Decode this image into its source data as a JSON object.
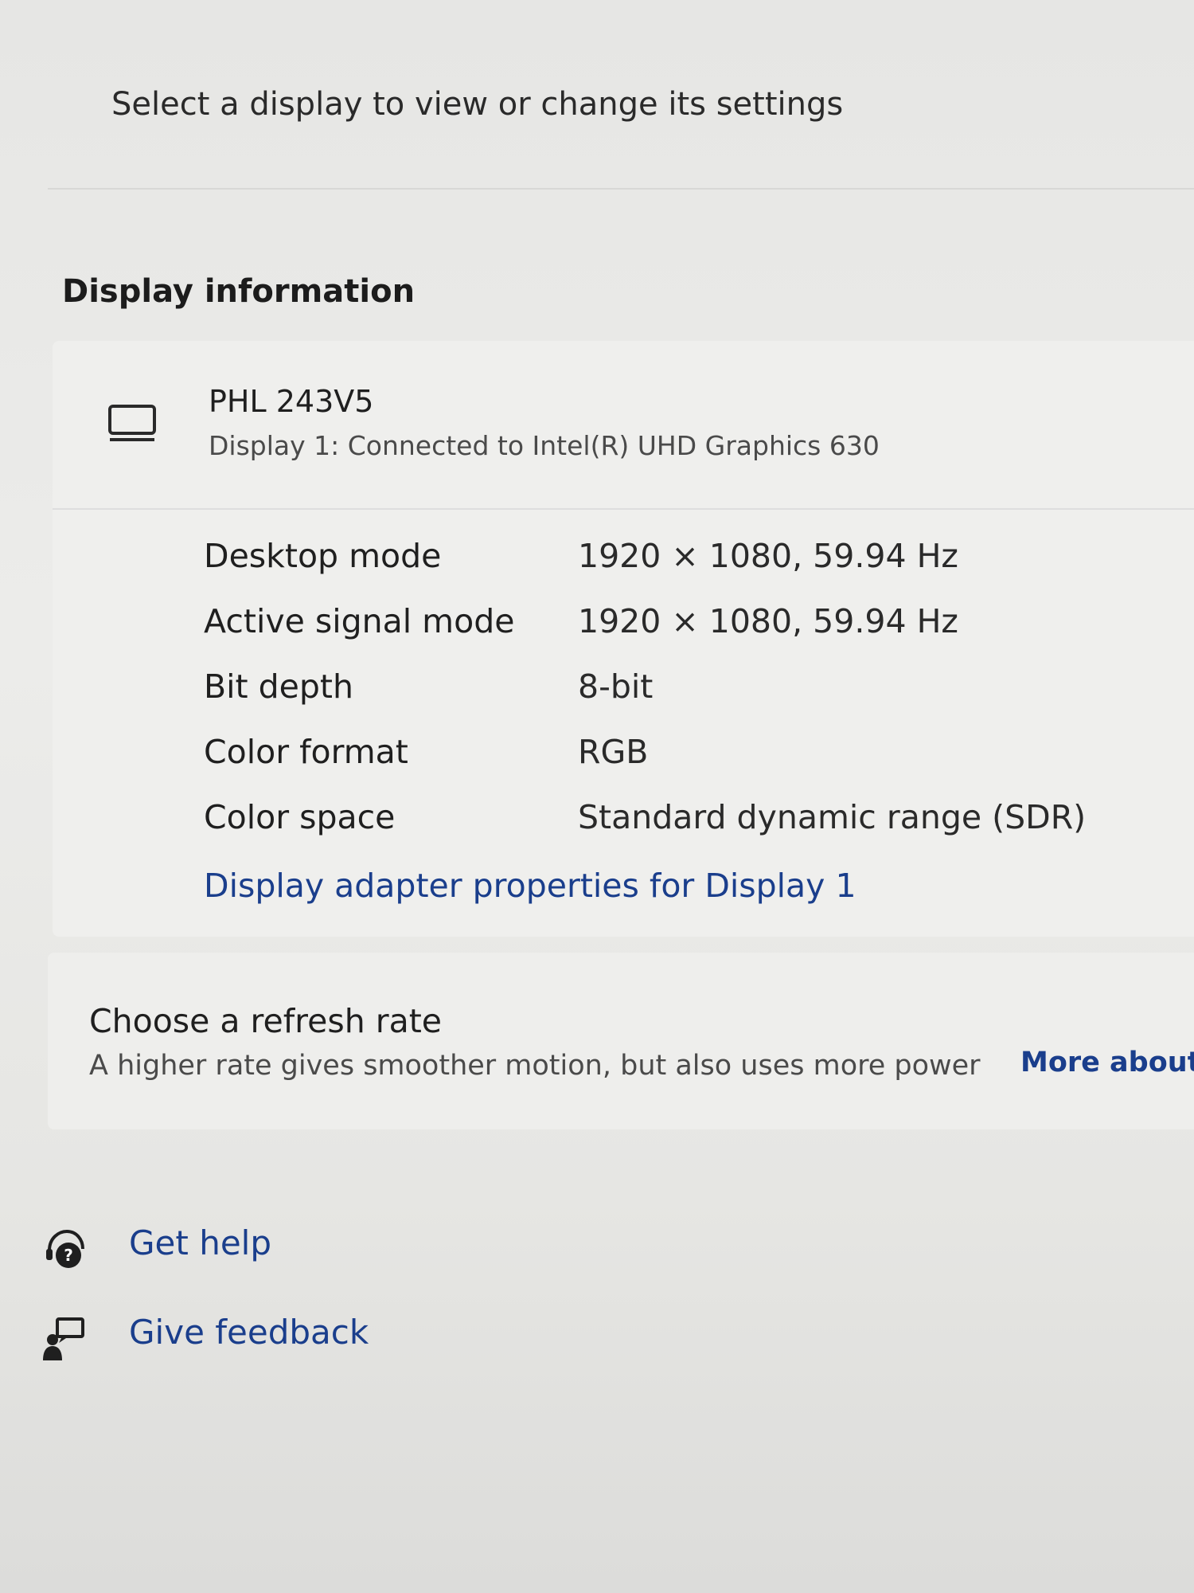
{
  "header": {
    "select_display_text": "Select a display to view or change its settings"
  },
  "display_information": {
    "section_title": "Display information",
    "monitor": {
      "name": "PHL 243V5",
      "connection": "Display 1: Connected to Intel(R) UHD Graphics 630",
      "icon": "monitor-icon"
    },
    "properties": [
      {
        "label": "Desktop mode",
        "value": "1920 × 1080, 59.94 Hz"
      },
      {
        "label": "Active signal mode",
        "value": "1920 × 1080, 59.94 Hz"
      },
      {
        "label": "Bit depth",
        "value": "8-bit"
      },
      {
        "label": "Color format",
        "value": "RGB"
      },
      {
        "label": "Color space",
        "value": "Standard dynamic range (SDR)"
      }
    ],
    "adapter_link": "Display adapter properties for Display 1"
  },
  "refresh_rate": {
    "title": "Choose a refresh rate",
    "description": "A higher rate gives smoother motion, but also uses more power",
    "more_link": "More about"
  },
  "help_links": [
    {
      "label": "Get help",
      "icon": "get-help-icon"
    },
    {
      "label": "Give feedback",
      "icon": "feedback-icon"
    }
  ],
  "colors": {
    "link": "#1a3e8c",
    "card_background": "#efefed",
    "page_background": "#e6e6e4"
  }
}
